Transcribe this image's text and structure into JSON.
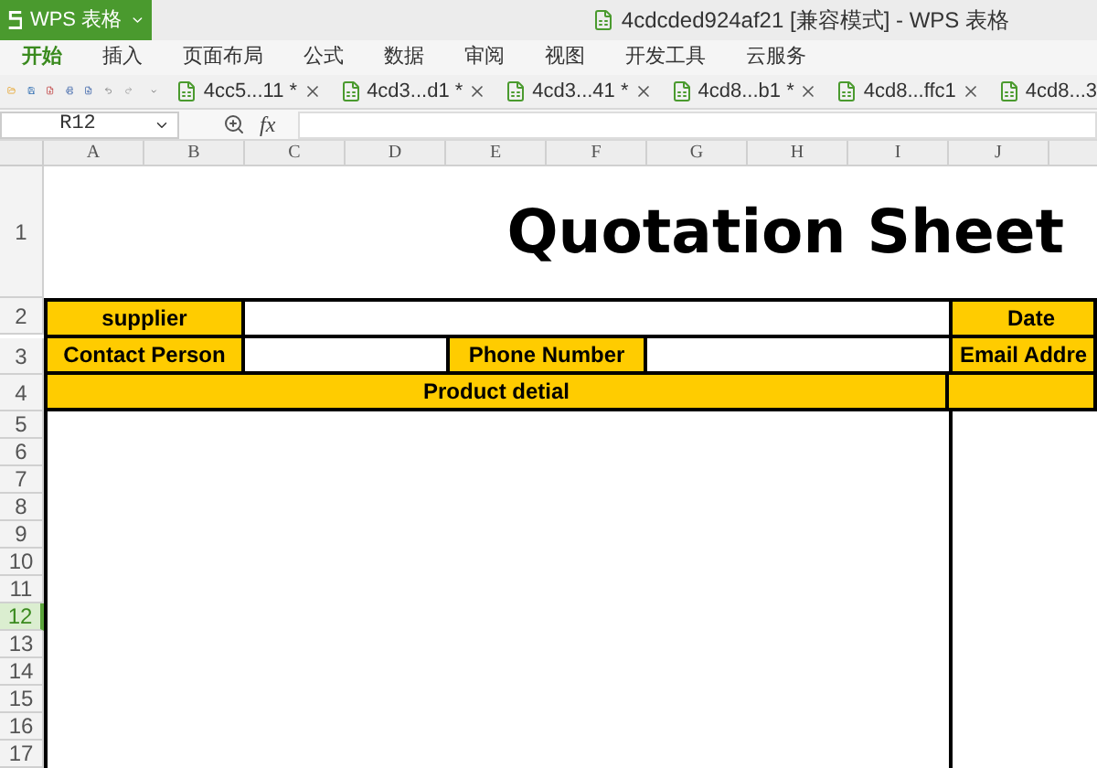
{
  "app": {
    "label": "WPS 表格"
  },
  "window": {
    "title": "4cdcded924af21 [兼容模式] - WPS 表格"
  },
  "menu": [
    {
      "label": "开始",
      "selected": true
    },
    {
      "label": "插入",
      "selected": false
    },
    {
      "label": "页面布局",
      "selected": false
    },
    {
      "label": "公式",
      "selected": false
    },
    {
      "label": "数据",
      "selected": false
    },
    {
      "label": "审阅",
      "selected": false
    },
    {
      "label": "视图",
      "selected": false
    },
    {
      "label": "开发工具",
      "selected": false
    },
    {
      "label": "云服务",
      "selected": false
    }
  ],
  "doc_tabs": [
    {
      "label": "4cc5...11 *"
    },
    {
      "label": "4cd3...d1 *"
    },
    {
      "label": "4cd3...41 *"
    },
    {
      "label": "4cd8...b1 *"
    },
    {
      "label": "4cd8...ffc1"
    },
    {
      "label": "4cd8...3"
    }
  ],
  "formula_bar": {
    "name_box": "R12",
    "fx_label": "fx"
  },
  "columns": [
    "A",
    "B",
    "C",
    "D",
    "E",
    "F",
    "G",
    "H",
    "I",
    "J"
  ],
  "rows": [
    {
      "label": "1",
      "selected": false
    },
    {
      "label": "2",
      "selected": false
    },
    {
      "label": "3",
      "selected": false
    },
    {
      "label": "4",
      "selected": false
    },
    {
      "label": "5",
      "selected": false
    },
    {
      "label": "6",
      "selected": false
    },
    {
      "label": "7",
      "selected": false
    },
    {
      "label": "8",
      "selected": false
    },
    {
      "label": "9",
      "selected": false
    },
    {
      "label": "10",
      "selected": false
    },
    {
      "label": "11",
      "selected": false
    },
    {
      "label": "12",
      "selected": true
    },
    {
      "label": "13",
      "selected": false
    },
    {
      "label": "14",
      "selected": false
    },
    {
      "label": "15",
      "selected": false
    },
    {
      "label": "16",
      "selected": false
    },
    {
      "label": "17",
      "selected": false
    }
  ],
  "sheet": {
    "title": "Quotation Sheet",
    "supplier_label": "supplier",
    "date_label": "Date",
    "contact_label": "Contact Person",
    "phone_label": "Phone Number",
    "email_label": "Email Addre",
    "product_label": "Product detial"
  }
}
